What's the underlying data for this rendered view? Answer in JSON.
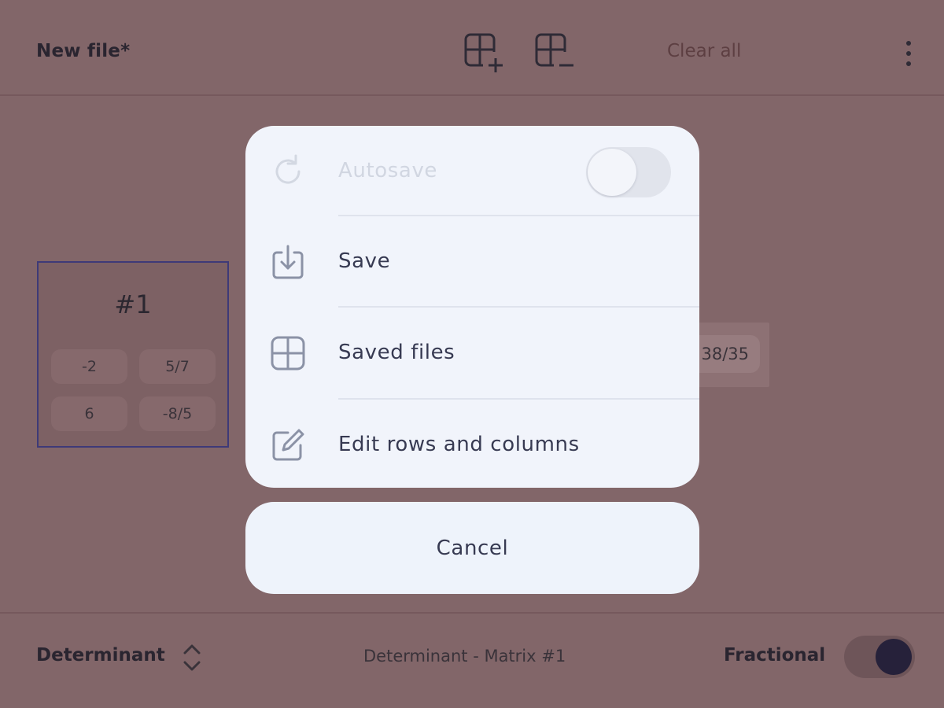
{
  "header": {
    "file_title": "New file*",
    "clear_all": "Clear all"
  },
  "matrix": {
    "title": "#1",
    "cells": [
      "-2",
      "5/7",
      "6",
      "-8/5"
    ]
  },
  "result": {
    "value": "38/35"
  },
  "menu": {
    "items": [
      {
        "label": "Autosave",
        "icon": "refresh-icon",
        "enabled": false,
        "toggle_on": false
      },
      {
        "label": "Save",
        "icon": "download-icon"
      },
      {
        "label": "Saved files",
        "icon": "grid-icon"
      },
      {
        "label": "Edit rows and columns",
        "icon": "edit-icon"
      }
    ],
    "cancel_label": "Cancel"
  },
  "footer": {
    "operation": "Determinant",
    "status": "Determinant - Matrix #1",
    "fractional_label": "Fractional",
    "fractional_on": true
  },
  "colors": {
    "overlay": "#826669",
    "sheet": "#f1f4fb",
    "accent_dark": "#26213a"
  }
}
